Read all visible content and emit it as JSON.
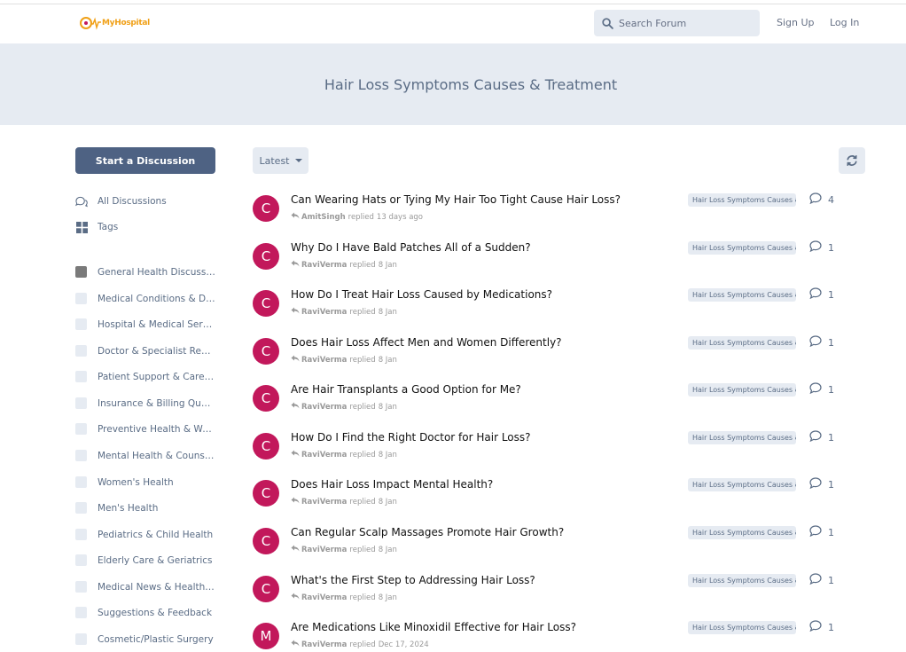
{
  "header": {
    "logo_text": "MyHospital",
    "search_placeholder": "Search Forum",
    "signup": "Sign Up",
    "login": "Log In"
  },
  "hero": {
    "title": "Hair Loss Symptoms Causes & Treatment"
  },
  "sidebar": {
    "start_button": "Start a Discussion",
    "nav": [
      {
        "label": "All Discussions",
        "icon": "discussions-icon"
      },
      {
        "label": "Tags",
        "icon": "tags-grid-icon"
      }
    ],
    "categories": [
      {
        "label": "General Health Discussions",
        "color": "#7a7a7a"
      },
      {
        "label": "Medical Conditions & Dis...",
        "color": "#e6ebf2"
      },
      {
        "label": "Hospital & Medical Services",
        "color": "#e6ebf2"
      },
      {
        "label": "Doctor & Specialist Reviews",
        "color": "#e6ebf2"
      },
      {
        "label": "Patient Support & Caregiv...",
        "color": "#e6ebf2"
      },
      {
        "label": "Insurance & Billing Questi...",
        "color": "#e6ebf2"
      },
      {
        "label": "Preventive Health & Welln...",
        "color": "#e6ebf2"
      },
      {
        "label": "Mental Health & Counseli...",
        "color": "#e6ebf2"
      },
      {
        "label": "Women's Health",
        "color": "#e6ebf2"
      },
      {
        "label": "Men's Health",
        "color": "#e6ebf2"
      },
      {
        "label": "Pediatrics & Child Health",
        "color": "#e6ebf2"
      },
      {
        "label": "Elderly Care & Geriatrics",
        "color": "#e6ebf2"
      },
      {
        "label": "Medical News & Health In...",
        "color": "#e6ebf2"
      },
      {
        "label": "Suggestions & Feedback",
        "color": "#e6ebf2"
      },
      {
        "label": "Cosmetic/Plastic Surgery",
        "color": "#e6ebf2"
      }
    ]
  },
  "toolbar": {
    "sort_label": "Latest",
    "refresh_icon": "refresh-icon"
  },
  "discussions": [
    {
      "avatar": "C",
      "title": "Can Wearing Hats or Tying My Hair Too Tight Cause Hair Loss?",
      "user": "AmitSingh",
      "action": "replied",
      "time": "13 days ago",
      "tag": "Hair Loss Symptoms Causes &",
      "replies": "4"
    },
    {
      "avatar": "C",
      "title": "Why Do I Have Bald Patches All of a Sudden?",
      "user": "RaviVerma",
      "action": "replied",
      "time": "8 Jan",
      "tag": "Hair Loss Symptoms Causes &",
      "replies": "1"
    },
    {
      "avatar": "C",
      "title": "How Do I Treat Hair Loss Caused by Medications?",
      "user": "RaviVerma",
      "action": "replied",
      "time": "8 Jan",
      "tag": "Hair Loss Symptoms Causes &",
      "replies": "1"
    },
    {
      "avatar": "C",
      "title": "Does Hair Loss Affect Men and Women Differently?",
      "user": "RaviVerma",
      "action": "replied",
      "time": "8 Jan",
      "tag": "Hair Loss Symptoms Causes &",
      "replies": "1"
    },
    {
      "avatar": "C",
      "title": "Are Hair Transplants a Good Option for Me?",
      "user": "RaviVerma",
      "action": "replied",
      "time": "8 Jan",
      "tag": "Hair Loss Symptoms Causes &",
      "replies": "1"
    },
    {
      "avatar": "C",
      "title": "How Do I Find the Right Doctor for Hair Loss?",
      "user": "RaviVerma",
      "action": "replied",
      "time": "8 Jan",
      "tag": "Hair Loss Symptoms Causes &",
      "replies": "1"
    },
    {
      "avatar": "C",
      "title": "Does Hair Loss Impact Mental Health?",
      "user": "RaviVerma",
      "action": "replied",
      "time": "8 Jan",
      "tag": "Hair Loss Symptoms Causes &",
      "replies": "1"
    },
    {
      "avatar": "C",
      "title": "Can Regular Scalp Massages Promote Hair Growth?",
      "user": "RaviVerma",
      "action": "replied",
      "time": "8 Jan",
      "tag": "Hair Loss Symptoms Causes &",
      "replies": "1"
    },
    {
      "avatar": "C",
      "title": "What's the First Step to Addressing Hair Loss?",
      "user": "RaviVerma",
      "action": "replied",
      "time": "8 Jan",
      "tag": "Hair Loss Symptoms Causes &",
      "replies": "1"
    },
    {
      "avatar": "M",
      "title": "Are Medications Like Minoxidil Effective for Hair Loss?",
      "user": "RaviVerma",
      "action": "replied",
      "time": "Dec 17, 2024",
      "tag": "Hair Loss Symptoms Causes &",
      "replies": "1"
    }
  ],
  "colors": {
    "accent": "#4e6283",
    "avatar": "#c2185b",
    "hero_bg": "#e6ebf2",
    "logo": "#f0a017"
  }
}
